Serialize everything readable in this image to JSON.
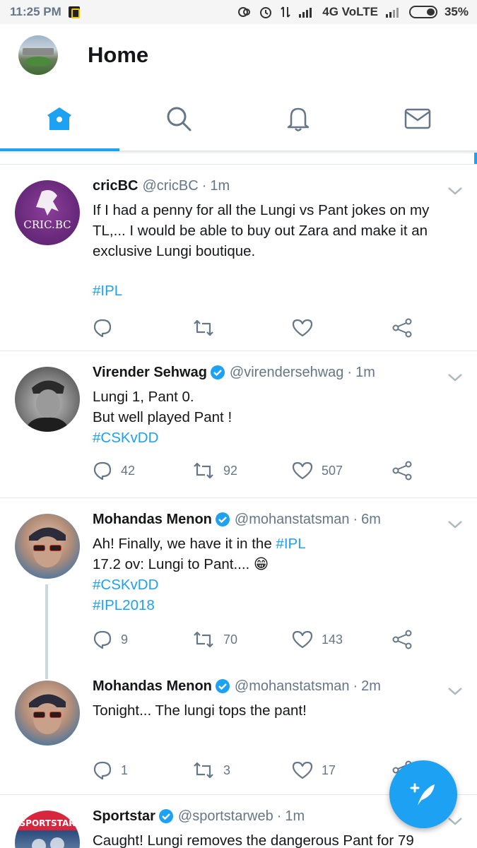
{
  "status_bar": {
    "time": "11:25 PM",
    "network": "4G VoLTE",
    "battery": "35%",
    "battery_level": 0.35
  },
  "header": {
    "title": "Home"
  },
  "tabs": [
    {
      "name": "home",
      "icon": "home-icon",
      "active": true
    },
    {
      "name": "search",
      "icon": "search-icon",
      "active": false
    },
    {
      "name": "notifications",
      "icon": "bell-icon",
      "active": false
    },
    {
      "name": "messages",
      "icon": "mail-icon",
      "active": false
    }
  ],
  "colors": {
    "accent": "#1da1f2",
    "secondary_text": "#657786",
    "primary_text": "#14171a",
    "divider": "#e1e8ed"
  },
  "tweets": [
    {
      "name": "cricBC",
      "verified": false,
      "handle": "@cricBC",
      "time": "1m",
      "avatar_text": "CRIC.BC",
      "text": "If I had a penny for all the Lungi vs Pant jokes on my TL,... I would be able to buy out Zara and make it an exclusive Lungi boutique.",
      "hashtag": "#IPL",
      "replies": "",
      "retweets": "",
      "likes": ""
    },
    {
      "name": "Virender Sehwag",
      "verified": true,
      "handle": "@virendersehwag",
      "time": "1m",
      "line1": "Lungi 1, Pant 0.",
      "line2": "But well played Pant !",
      "hashtag": "#CSKvDD",
      "replies": "42",
      "retweets": "92",
      "likes": "507"
    },
    {
      "name": "Mohandas Menon",
      "verified": true,
      "handle": "@mohanstatsman",
      "time": "6m",
      "line1_prefix": "Ah! Finally, we have it in the",
      "line1_hashtag": "#IPL",
      "line2": "17.2 ov: Lungi to Pant.... 😁",
      "hashtag1": "#CSKvDD",
      "hashtag2": "#IPL2018",
      "replies": "9",
      "retweets": "70",
      "likes": "143"
    },
    {
      "name": "Mohandas Menon",
      "verified": true,
      "handle": "@mohanstatsman",
      "time": "2m",
      "text": "Tonight... The lungi tops the pant!",
      "replies": "1",
      "retweets": "3",
      "likes": "17"
    },
    {
      "name": "Sportstar",
      "verified": true,
      "handle": "@sportstarweb",
      "time": "1m",
      "avatar_text": "SPORTSTAR",
      "text": "Caught! Lungi removes the dangerous Pant for 79"
    }
  ],
  "fab": {
    "icon": "compose-tweet-icon"
  }
}
